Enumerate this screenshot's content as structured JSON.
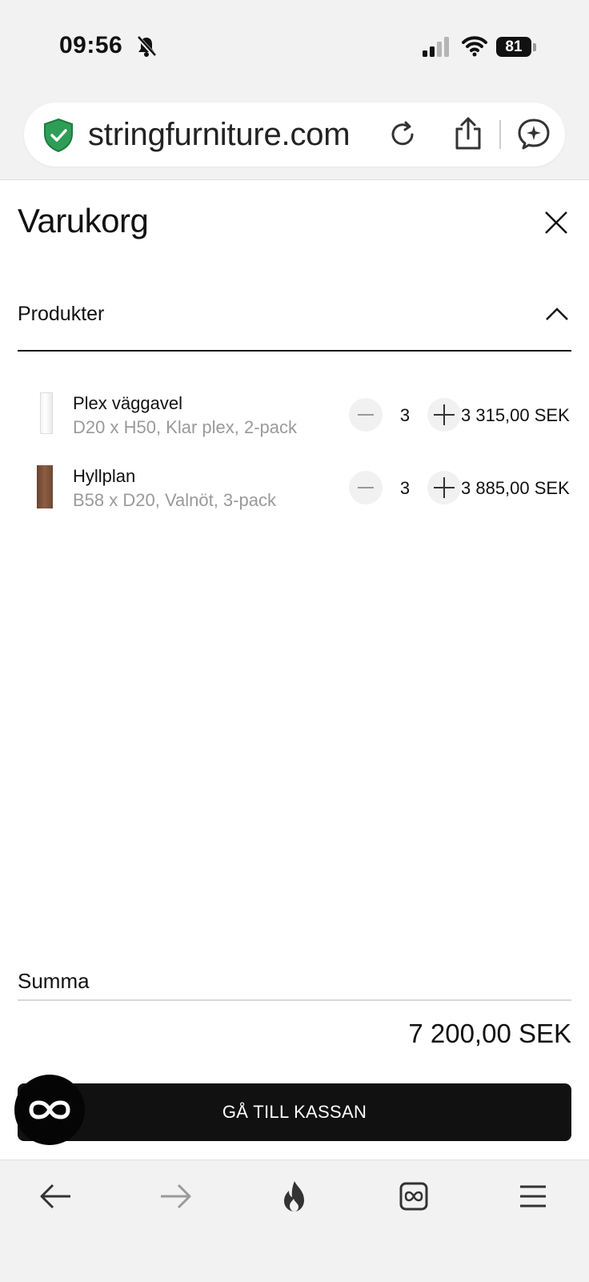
{
  "status_bar": {
    "time": "09:56",
    "battery": "81"
  },
  "browser": {
    "url": "stringfurniture.com"
  },
  "cart": {
    "title": "Varukorg",
    "section_label": "Produkter",
    "items": [
      {
        "name": "Plex väggavel",
        "variant": "D20 x H50, Klar plex, 2-pack",
        "quantity": "3",
        "price": "3 315,00 SEK"
      },
      {
        "name": "Hyllplan",
        "variant": "B58 x D20, Valnöt, 3-pack",
        "quantity": "3",
        "price": "3 885,00 SEK"
      }
    ],
    "sum_label": "Summa",
    "total": "7 200,00 SEK",
    "checkout_label": "GÅ TILL KASSAN"
  },
  "colors": {
    "shield_green": "#2e9e57",
    "button_dark": "#111111"
  }
}
